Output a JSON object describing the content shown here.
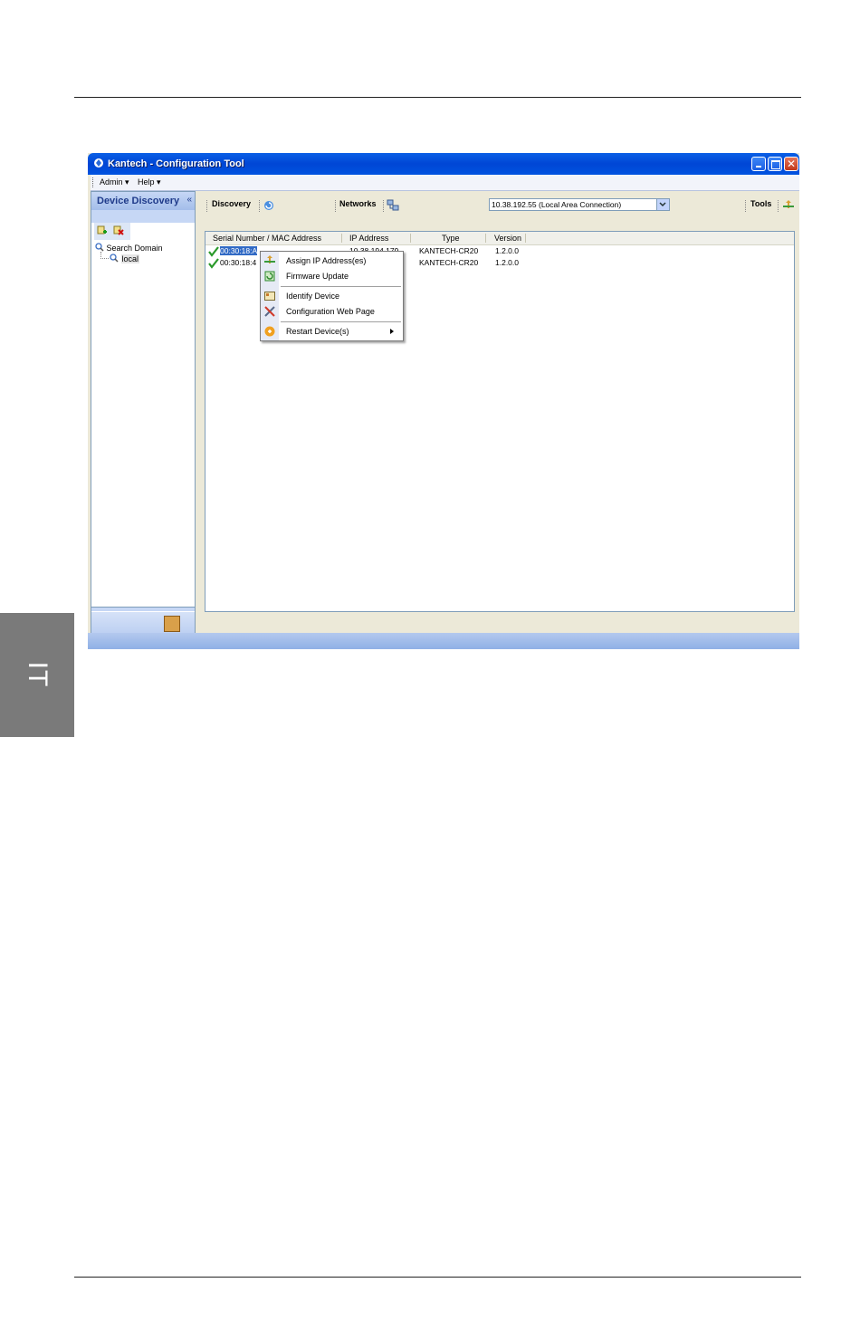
{
  "page": {
    "side_tab_label": "IT"
  },
  "window": {
    "title": "Kantech - Configuration Tool",
    "menu": [
      "Admin",
      "Help"
    ]
  },
  "left_pane": {
    "title": "Device Discovery",
    "collapse_glyph": "«",
    "tree": [
      {
        "label": "Search Domain",
        "icon": "search-icon"
      },
      {
        "label": "local",
        "icon": "search-icon"
      }
    ]
  },
  "toolbar": {
    "discovery_label": "Discovery",
    "networks_label": "Networks",
    "network_selected": "10.38.192.55 (Local Area Connection)",
    "tools_label": "Tools"
  },
  "device_list": {
    "columns": [
      "Serial Number / MAC Address",
      "IP Address",
      "Type",
      "Version"
    ],
    "rows": [
      {
        "mac": "00:30:18:A",
        "ip": "10.38.194.179",
        "type": "KANTECH-CR20",
        "version": "1.2.0.0",
        "selected": true
      },
      {
        "mac": "00:30:18:4",
        "ip": "",
        "type": "KANTECH-CR20",
        "version": "1.2.0.0",
        "selected": false
      }
    ]
  },
  "context_menu": {
    "items": [
      {
        "label": "Assign IP Address(es)",
        "icon": "assign-ip-icon"
      },
      {
        "label": "Firmware Update",
        "icon": "firmware-icon"
      },
      {
        "label": "Identify Device",
        "icon": "identify-icon"
      },
      {
        "label": "Configuration Web Page",
        "icon": "tools-icon"
      },
      {
        "label": "Restart Device(s)",
        "icon": "restart-icon",
        "submenu": true
      }
    ]
  },
  "colors": {
    "title_bar": "#0046d5",
    "selection": "#316ac5",
    "side_tab": "#7a7a7a",
    "pane_header": "#a3bdea"
  }
}
